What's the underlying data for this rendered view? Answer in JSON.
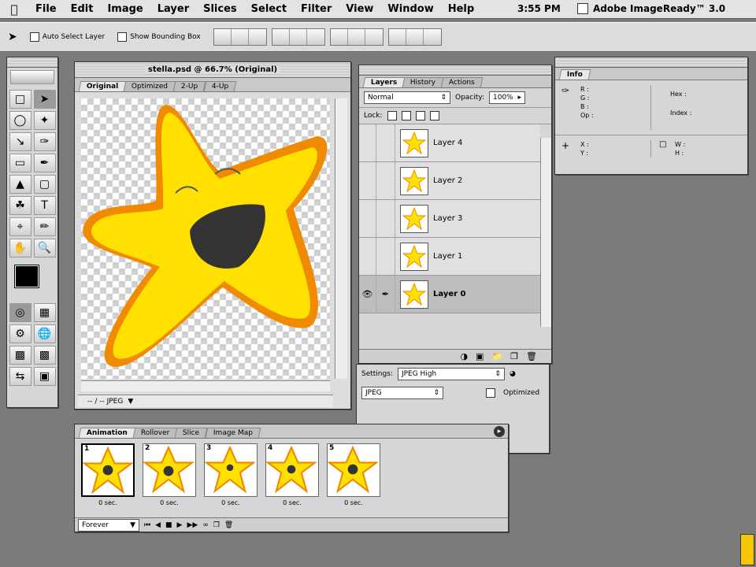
{
  "menubar": {
    "apple_icon": "apple-icon",
    "items": [
      "File",
      "Edit",
      "Image",
      "Layer",
      "Slices",
      "Select",
      "Filter",
      "View",
      "Window",
      "Help"
    ],
    "clock": "3:55 PM",
    "app_title": "Adobe ImageReady™ 3.0"
  },
  "options_bar": {
    "auto_select_label": "Auto Select Layer",
    "show_bounding_label": "Show Bounding Box"
  },
  "document": {
    "title": "stella.psd @ 66.7% (Original)",
    "tabs": [
      "Original",
      "Optimized",
      "2-Up",
      "4-Up"
    ],
    "active_tab": "Original",
    "status": "-- / -- JPEG"
  },
  "layers_panel": {
    "tabs": [
      "Layers",
      "History",
      "Actions"
    ],
    "blend_mode": "Normal",
    "opacity_label": "Opacity:",
    "opacity_value": "100%",
    "lock_label": "Lock:",
    "layers": [
      {
        "name": "Layer 4",
        "selected": false
      },
      {
        "name": "Layer 2",
        "selected": false
      },
      {
        "name": "Layer 3",
        "selected": false
      },
      {
        "name": "Layer 1",
        "selected": false
      },
      {
        "name": "Layer 0",
        "selected": true
      }
    ]
  },
  "optimize_panel": {
    "settings_label": "Settings:",
    "settings_value": "JPEG High",
    "format_value": "JPEG",
    "optimized_label": "Optimized"
  },
  "info_panel": {
    "tab": "Info",
    "r": "R :",
    "g": "G :",
    "b": "B :",
    "op": "Op :",
    "hex": "Hex :",
    "index": "Index :",
    "x": "X :",
    "y": "Y :",
    "w": "W :",
    "h": "H :"
  },
  "animation_panel": {
    "tabs": [
      "Animation",
      "Rollover",
      "Slice",
      "Image Map"
    ],
    "frames": [
      {
        "num": "1",
        "delay": "0 sec."
      },
      {
        "num": "2",
        "delay": "0 sec."
      },
      {
        "num": "3",
        "delay": "0 sec."
      },
      {
        "num": "4",
        "delay": "0 sec."
      },
      {
        "num": "5",
        "delay": "0 sec."
      }
    ],
    "loop": "Forever"
  },
  "colors": {
    "star_yellow": "#ffe000",
    "star_orange": "#f08a00",
    "star_mouth": "#333333"
  }
}
